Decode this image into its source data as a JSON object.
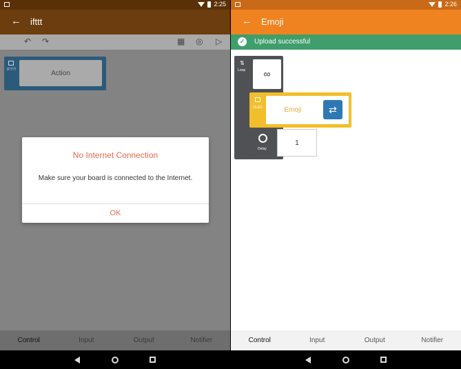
{
  "left": {
    "status_time": "2:25",
    "title": "ifttt",
    "block": {
      "label": "IFTTT",
      "action": "Action"
    },
    "dialog": {
      "title": "No Internet Connection",
      "message": "Make sure your board is connected to the Internet.",
      "ok": "OK"
    },
    "tabs": [
      "Control",
      "Input",
      "Output",
      "Notifier"
    ]
  },
  "right": {
    "status_time": "2:26",
    "title": "Emoji",
    "upload_message": "Upload successful",
    "loop": {
      "label": "Loop",
      "value": "∞"
    },
    "oled": {
      "label": "OLED",
      "text": "Emoji"
    },
    "delay": {
      "label": "Delay",
      "value": "1"
    },
    "tabs": [
      "Control",
      "Input",
      "Output",
      "Notifier"
    ]
  },
  "colors": {
    "left_appbar": "#6b3d0f",
    "right_appbar": "#ef8320",
    "upload_green": "#3f9e6b",
    "dialog_accent": "#e8664d"
  }
}
